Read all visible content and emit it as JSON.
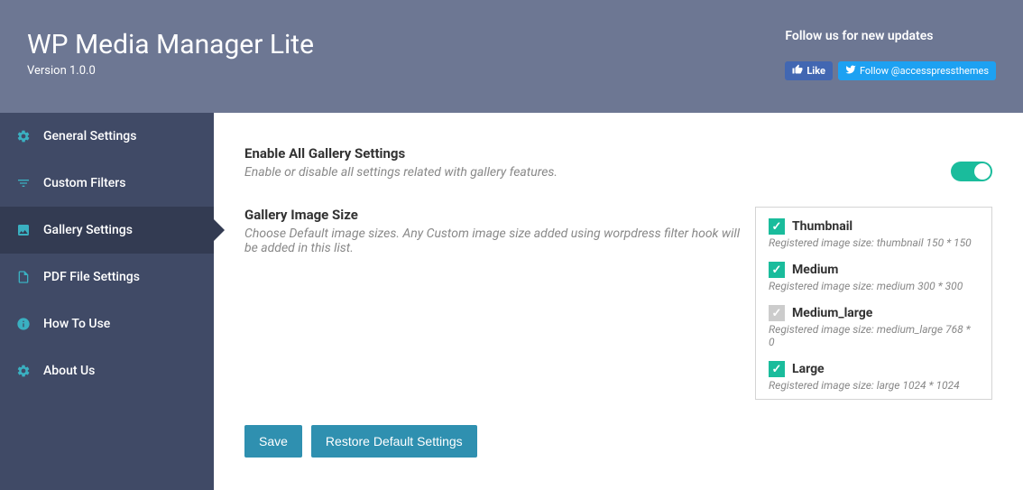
{
  "header": {
    "title": "WP Media Manager Lite",
    "version": "Version 1.0.0",
    "follow_text": "Follow us for new updates",
    "fb_like": "Like",
    "tw_follow": "Follow @accesspressthemes"
  },
  "sidebar": {
    "items": [
      {
        "label": "General Settings"
      },
      {
        "label": "Custom Filters"
      },
      {
        "label": "Gallery Settings"
      },
      {
        "label": "PDF File Settings"
      },
      {
        "label": "How To Use"
      },
      {
        "label": "About Us"
      }
    ]
  },
  "settings": {
    "enable_all": {
      "title": "Enable All Gallery Settings",
      "desc": "Enable or disable all settings related with gallery features."
    },
    "image_size": {
      "title": "Gallery Image Size",
      "desc": "Choose Default image sizes. Any Custom image size added using worpdress filter hook will be added in this list."
    }
  },
  "sizes": [
    {
      "name": "Thumbnail",
      "meta": "Registered image size: thumbnail 150 * 150",
      "checked": true
    },
    {
      "name": "Medium",
      "meta": "Registered image size: medium 300 * 300",
      "checked": true
    },
    {
      "name": "Medium_large",
      "meta": "Registered image size: medium_large 768 * 0",
      "checked": false
    },
    {
      "name": "Large",
      "meta": "Registered image size: large 1024 * 1024",
      "checked": true
    }
  ],
  "buttons": {
    "save": "Save",
    "restore": "Restore Default Settings"
  }
}
